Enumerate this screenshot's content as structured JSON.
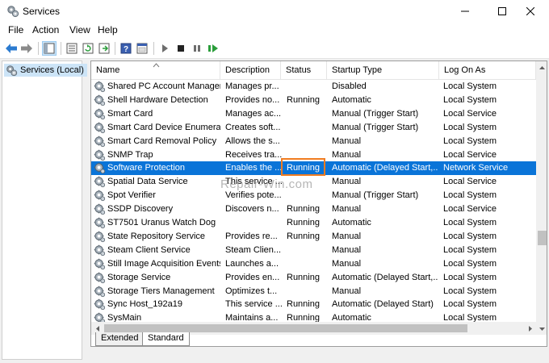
{
  "window": {
    "title": "Services"
  },
  "menu": {
    "file": "File",
    "action": "Action",
    "view": "View",
    "help": "Help"
  },
  "toolbar": {
    "icons": [
      "back-icon",
      "forward-icon",
      "show-hide-tree-icon",
      "properties-icon",
      "refresh-icon",
      "export-list-icon",
      "help-icon",
      "console-icon",
      "start-icon",
      "stop-icon",
      "pause-icon",
      "restart-icon"
    ]
  },
  "tree": {
    "root_label": "Services (Local)"
  },
  "columns": {
    "name": "Name",
    "description": "Description",
    "status": "Status",
    "startup": "Startup Type",
    "logon": "Log On As"
  },
  "rows": [
    {
      "name": "Shared PC Account Manager",
      "description": "Manages pr...",
      "status": "",
      "startup": "Disabled",
      "logon": "Local System"
    },
    {
      "name": "Shell Hardware Detection",
      "description": "Provides no...",
      "status": "Running",
      "startup": "Automatic",
      "logon": "Local System"
    },
    {
      "name": "Smart Card",
      "description": "Manages ac...",
      "status": "",
      "startup": "Manual (Trigger Start)",
      "logon": "Local Service"
    },
    {
      "name": "Smart Card Device Enumera...",
      "description": "Creates soft...",
      "status": "",
      "startup": "Manual (Trigger Start)",
      "logon": "Local System"
    },
    {
      "name": "Smart Card Removal Policy",
      "description": "Allows the s...",
      "status": "",
      "startup": "Manual",
      "logon": "Local System"
    },
    {
      "name": "SNMP Trap",
      "description": "Receives tra...",
      "status": "",
      "startup": "Manual",
      "logon": "Local Service"
    },
    {
      "name": "Software Protection",
      "description": "Enables the ...",
      "status": "Running",
      "startup": "Automatic (Delayed Start,...",
      "logon": "Network Service"
    },
    {
      "name": "Spatial Data Service",
      "description": "This service ...",
      "status": "",
      "startup": "Manual",
      "logon": "Local Service"
    },
    {
      "name": "Spot Verifier",
      "description": "Verifies pote...",
      "status": "",
      "startup": "Manual (Trigger Start)",
      "logon": "Local System"
    },
    {
      "name": "SSDP Discovery",
      "description": "Discovers n...",
      "status": "Running",
      "startup": "Manual",
      "logon": "Local Service"
    },
    {
      "name": "ST7501 Uranus Watch Dog",
      "description": "",
      "status": "Running",
      "startup": "Automatic",
      "logon": "Local System"
    },
    {
      "name": "State Repository Service",
      "description": "Provides re...",
      "status": "Running",
      "startup": "Manual",
      "logon": "Local System"
    },
    {
      "name": "Steam Client Service",
      "description": "Steam Clien...",
      "status": "",
      "startup": "Manual",
      "logon": "Local System"
    },
    {
      "name": "Still Image Acquisition Events",
      "description": "Launches a...",
      "status": "",
      "startup": "Manual",
      "logon": "Local System"
    },
    {
      "name": "Storage Service",
      "description": "Provides en...",
      "status": "Running",
      "startup": "Automatic (Delayed Start,...",
      "logon": "Local System"
    },
    {
      "name": "Storage Tiers Management",
      "description": "Optimizes t...",
      "status": "",
      "startup": "Manual",
      "logon": "Local System"
    },
    {
      "name": "Sync Host_192a19",
      "description": "This service ...",
      "status": "Running",
      "startup": "Automatic (Delayed Start)",
      "logon": "Local System"
    },
    {
      "name": "SysMain",
      "description": "Maintains a...",
      "status": "Running",
      "startup": "Automatic",
      "logon": "Local System"
    }
  ],
  "selected_row": "Software Protection",
  "watermark": "Repair-Win.com",
  "tabs": {
    "extended": "Extended",
    "standard": "Standard"
  },
  "colors": {
    "selection": "#0a74d8",
    "highlight_box": "#f07c21"
  }
}
